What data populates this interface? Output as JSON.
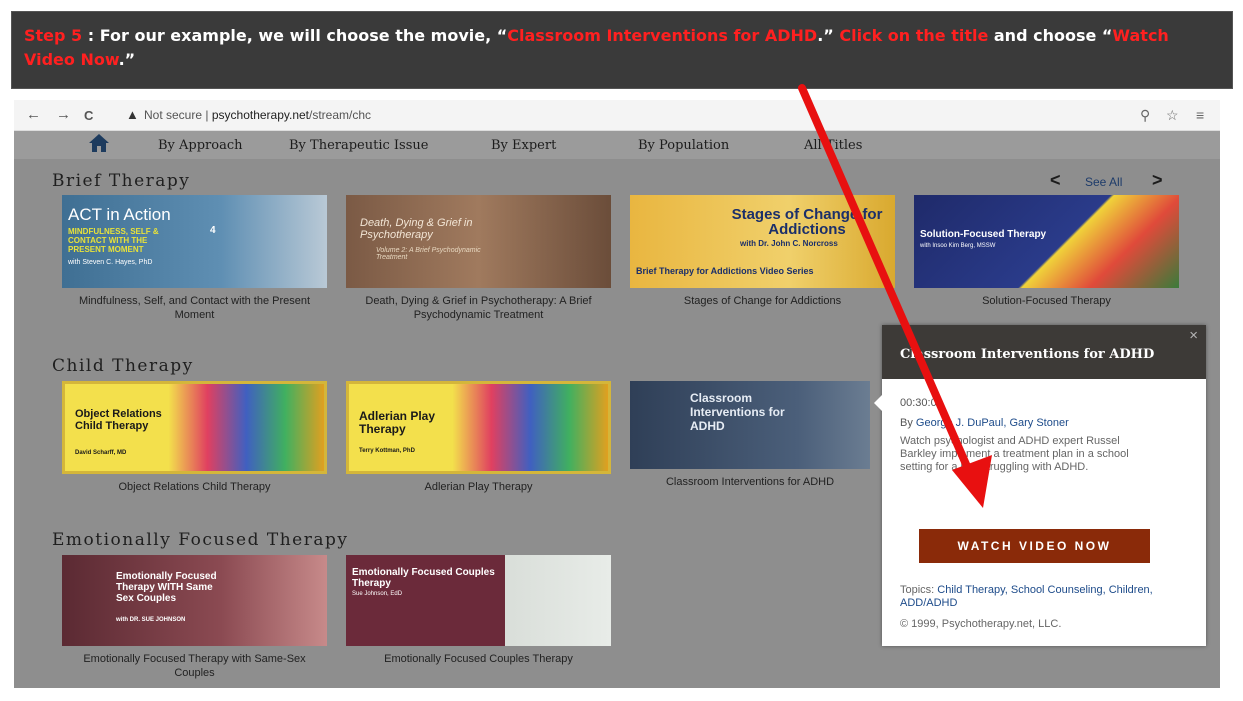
{
  "banner": {
    "step": "Step 5",
    "text1": " : For our example, we will choose the movie, “",
    "movie": "Classroom Interventions for ADHD",
    "text2": ".” ",
    "click": "Click on the title",
    "text3": " and choose “",
    "watch": "Watch Video Now",
    "text4": ".”"
  },
  "browser": {
    "back": "←",
    "forward": "→",
    "reload": "C",
    "warning_icon": "▲",
    "not_secure": "Not secure",
    "separator": "|",
    "domain": "psychotherapy.net",
    "path": "/stream/chc",
    "zoom_icon": "⚲",
    "star_icon": "☆",
    "menu_icon": "≡"
  },
  "nav": {
    "home_icon": "home-icon",
    "items": [
      "By Approach",
      "By Therapeutic Issue",
      "By Expert",
      "By Population",
      "All Titles"
    ]
  },
  "sections": {
    "brief": {
      "title": "Brief Therapy",
      "see_all": "See All",
      "cards": [
        {
          "caption": "Mindfulness, Self, and Contact with the Present Moment",
          "thumb_title": "ACT in Action",
          "thumb_sub": "MINDFULNESS, SELF & CONTACT WITH THE PRESENT MOMENT",
          "thumb_author": "with Steven C. Hayes, PhD",
          "thumb_num": "4"
        },
        {
          "caption": "Death, Dying & Grief in Psychotherapy: A Brief Psychodynamic Treatment",
          "thumb_title": "Death, Dying & Grief in Psychotherapy",
          "thumb_sub": "Volume 2: A Brief Psychodynamic Treatment"
        },
        {
          "caption": "Stages of Change for Addictions",
          "thumb_title": "Stages of Change for Addictions",
          "thumb_author": "with Dr. John C. Norcross",
          "thumb_sub": "Brief Therapy for Addictions Video Series"
        },
        {
          "caption": "Solution-Focused Therapy",
          "thumb_title": "Solution-Focused Therapy",
          "thumb_author": "with Insoo Kim Berg, MSSW"
        }
      ]
    },
    "child": {
      "title": "Child Therapy",
      "cards": [
        {
          "caption": "Object Relations Child Therapy",
          "thumb_title": "Object Relations Child Therapy",
          "thumb_author": "David Scharff, MD"
        },
        {
          "caption": "Adlerian Play Therapy",
          "thumb_title": "Adlerian Play Therapy",
          "thumb_author": "Terry Kottman, PhD"
        },
        {
          "caption": "Classroom Interventions for ADHD",
          "thumb_title": "Classroom Interventions for ADHD"
        }
      ]
    },
    "ef": {
      "title": "Emotionally Focused Therapy",
      "cards": [
        {
          "caption": "Emotionally Focused Therapy with Same-Sex Couples",
          "thumb_title": "Emotionally Focused Therapy WITH Same Sex Couples",
          "thumb_author": "with DR. SUE JOHNSON"
        },
        {
          "caption": "Emotionally Focused Couples Therapy",
          "thumb_title": "Emotionally Focused Couples Therapy",
          "thumb_author": "Sue Johnson, EdD"
        }
      ]
    }
  },
  "popup": {
    "title": "Classroom Interventions for ADHD",
    "close": "×",
    "duration": "00:30:00",
    "by": "By ",
    "authors": "George J. DuPaul, Gary Stoner",
    "description": "Watch psychologist and ADHD expert Russel Barkley implement a treatment plan in a school setting for a boy struggling with ADHD.",
    "button": "WATCH VIDEO NOW",
    "topics_label": "Topics: ",
    "topics": "Child Therapy, School Counseling, Children, ADD/ADHD",
    "copyright": "© 1999, Psychotherapy.net, LLC."
  },
  "colors": {
    "banner_bg": "#3a3a3a",
    "highlight": "#ff2020",
    "button": "#8a2a09",
    "link": "#1d4b8a",
    "arrow": "#e81010"
  }
}
